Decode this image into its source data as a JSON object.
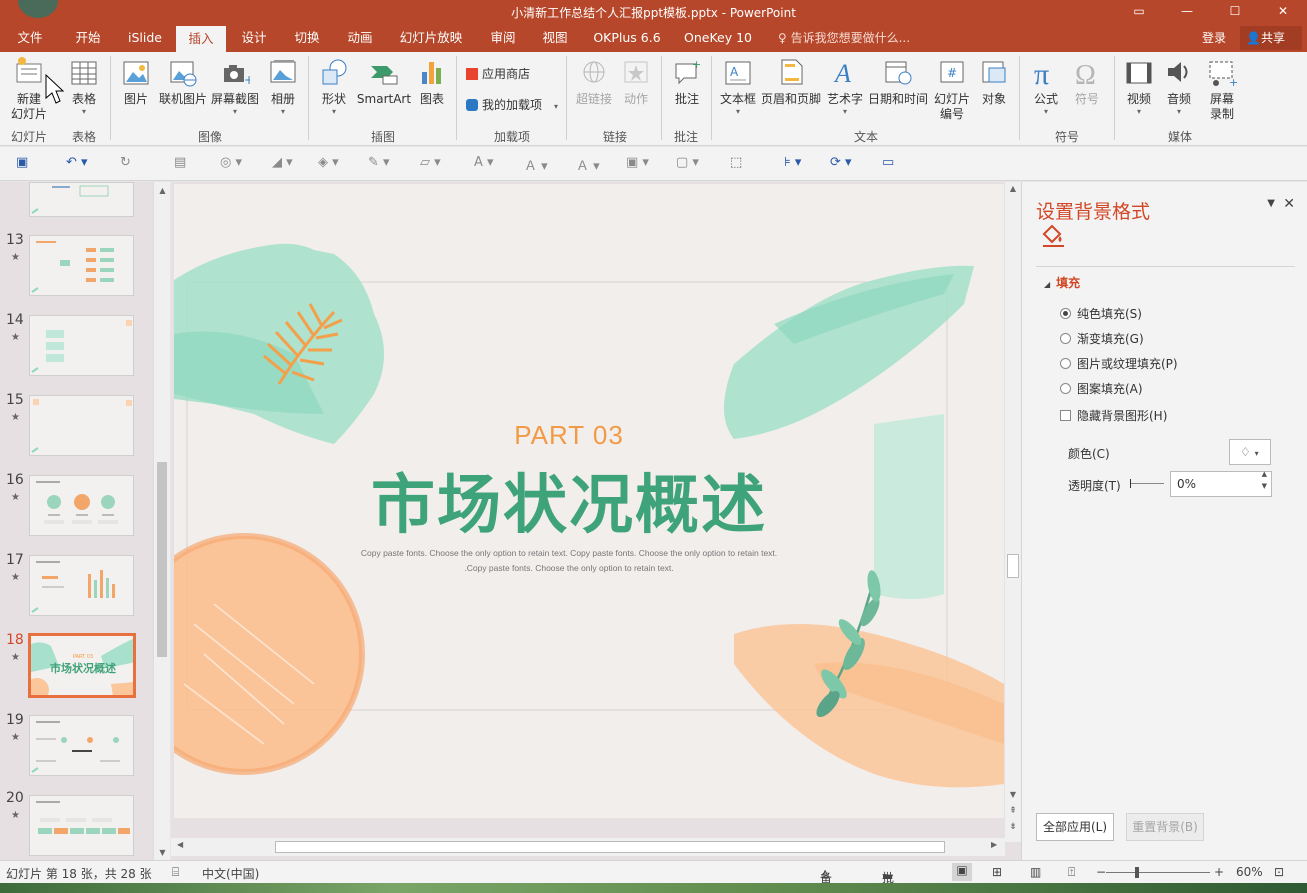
{
  "window": {
    "title": "小清新工作总结个人汇报ppt模板.pptx - PowerPoint",
    "controls": [
      "▭",
      "—",
      "☐",
      "✕"
    ]
  },
  "tabs": {
    "items": [
      "文件",
      "开始",
      "iSlide",
      "插入",
      "设计",
      "切换",
      "动画",
      "幻灯片放映",
      "审阅",
      "视图",
      "OKPlus 6.6",
      "OneKey 10"
    ],
    "search": "告诉我您想要做什么...",
    "login": "登录",
    "share": "共享"
  },
  "ribbon": {
    "new_slide": "新建\n幻灯片",
    "table": "表格",
    "picture": "图片",
    "online_picture": "联机图片",
    "screenshot": "屏幕截图",
    "album": "相册",
    "shapes": "形状",
    "smartart": "SmartArt",
    "chart": "图表",
    "store": "应用商店",
    "my_addins": "我的加载项",
    "hyperlink": "超链接",
    "action": "动作",
    "comment": "批注",
    "textbox": "文本框",
    "header_footer": "页眉和页脚",
    "wordart": "艺术字",
    "datetime": "日期和时间",
    "slide_number": "幻灯片\n编号",
    "object": "对象",
    "equation": "公式",
    "symbol": "符号",
    "video": "视频",
    "audio": "音频",
    "screen_record": "屏幕\n录制",
    "groups": {
      "slides": "幻灯片",
      "tables": "表格",
      "images": "图像",
      "illustrations": "插图",
      "addins": "加载项",
      "links": "链接",
      "comments": "批注",
      "text": "文本",
      "symbols": "符号",
      "media": "媒体"
    }
  },
  "thumbnails": [
    {
      "num": "13"
    },
    {
      "num": "14"
    },
    {
      "num": "15"
    },
    {
      "num": "16"
    },
    {
      "num": "17"
    },
    {
      "num": "18"
    },
    {
      "num": "19"
    },
    {
      "num": "20"
    }
  ],
  "slide": {
    "part": "PART 03",
    "title": "市场状况概述",
    "sub1": "Copy paste fonts. Choose the only option to retain text. Copy paste fonts. Choose the only option to retain text.",
    "sub2": ".Copy paste fonts. Choose the only option to retain text.",
    "thumb_part": "PART 03",
    "thumb_title": "市场状况概述"
  },
  "pane": {
    "title": "设置背景格式",
    "section": "填充",
    "options": [
      "纯色填充(S)",
      "渐变填充(G)",
      "图片或纹理填充(P)",
      "图案填充(A)"
    ],
    "selected_option": "纯色填充(S)",
    "hide_bg": "隐藏背景图形(H)",
    "color_label": "颜色(C)",
    "transparency_label": "透明度(T)",
    "transparency_value": "0%",
    "apply_all": "全部应用(L)",
    "reset_bg": "重置背景(B)"
  },
  "status": {
    "slide_info": "幻灯片 第 18 张，共 28 张",
    "language": "中文(中国)",
    "notes": "备注",
    "comments": "批注",
    "zoom": "60%"
  },
  "colors": {
    "accent": "#b7472a",
    "title_green": "#3fa37a",
    "part_orange": "#f29a45",
    "mint": "#8fd8bf",
    "peach": "#fbbf8f"
  }
}
